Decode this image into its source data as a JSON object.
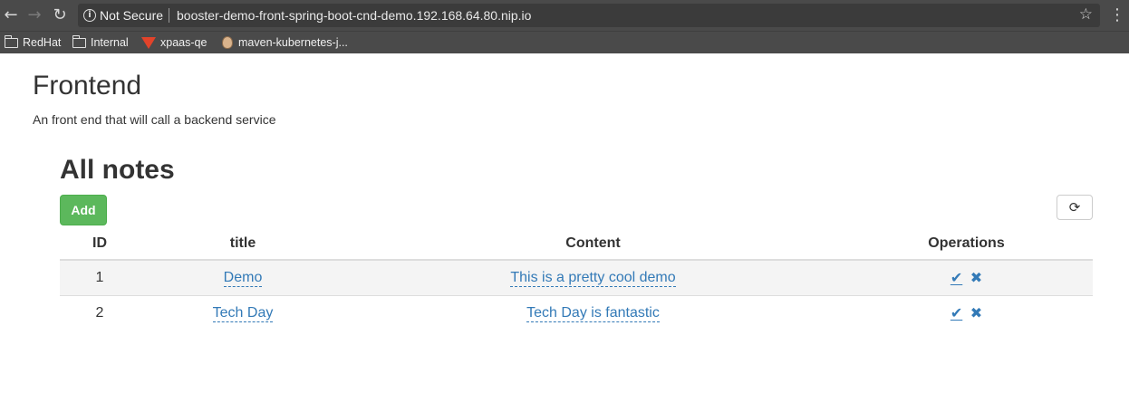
{
  "browser": {
    "security_label": "Not Secure",
    "url": "booster-demo-front-spring-boot-cnd-demo.192.168.64.80.nip.io",
    "bookmarks": [
      "RedHat",
      "Internal",
      "xpaas-qe",
      "maven-kubernetes-j..."
    ]
  },
  "app": {
    "title": "Frontend",
    "subtitle": "An front end that will call a backend service"
  },
  "notes": {
    "heading": "All notes",
    "add_label": "Add",
    "columns": [
      "ID",
      "title",
      "Content",
      "Operations"
    ],
    "rows": [
      {
        "id": "1",
        "title": "Demo",
        "content": "This is a pretty cool demo"
      },
      {
        "id": "2",
        "title": "Tech Day",
        "content": "Tech Day is fantastic"
      }
    ]
  },
  "colors": {
    "add_button": "#5cb85c",
    "link": "#337ab7",
    "chrome": "#4a4a4a"
  },
  "icons": {
    "back": "arrow-left",
    "forward": "arrow-right",
    "reload": "reload",
    "info": "info-circle",
    "bookmark_star": "star",
    "menu": "vertical-ellipsis",
    "refresh": "refresh",
    "edit": "check-edit",
    "delete": "remove-x"
  }
}
